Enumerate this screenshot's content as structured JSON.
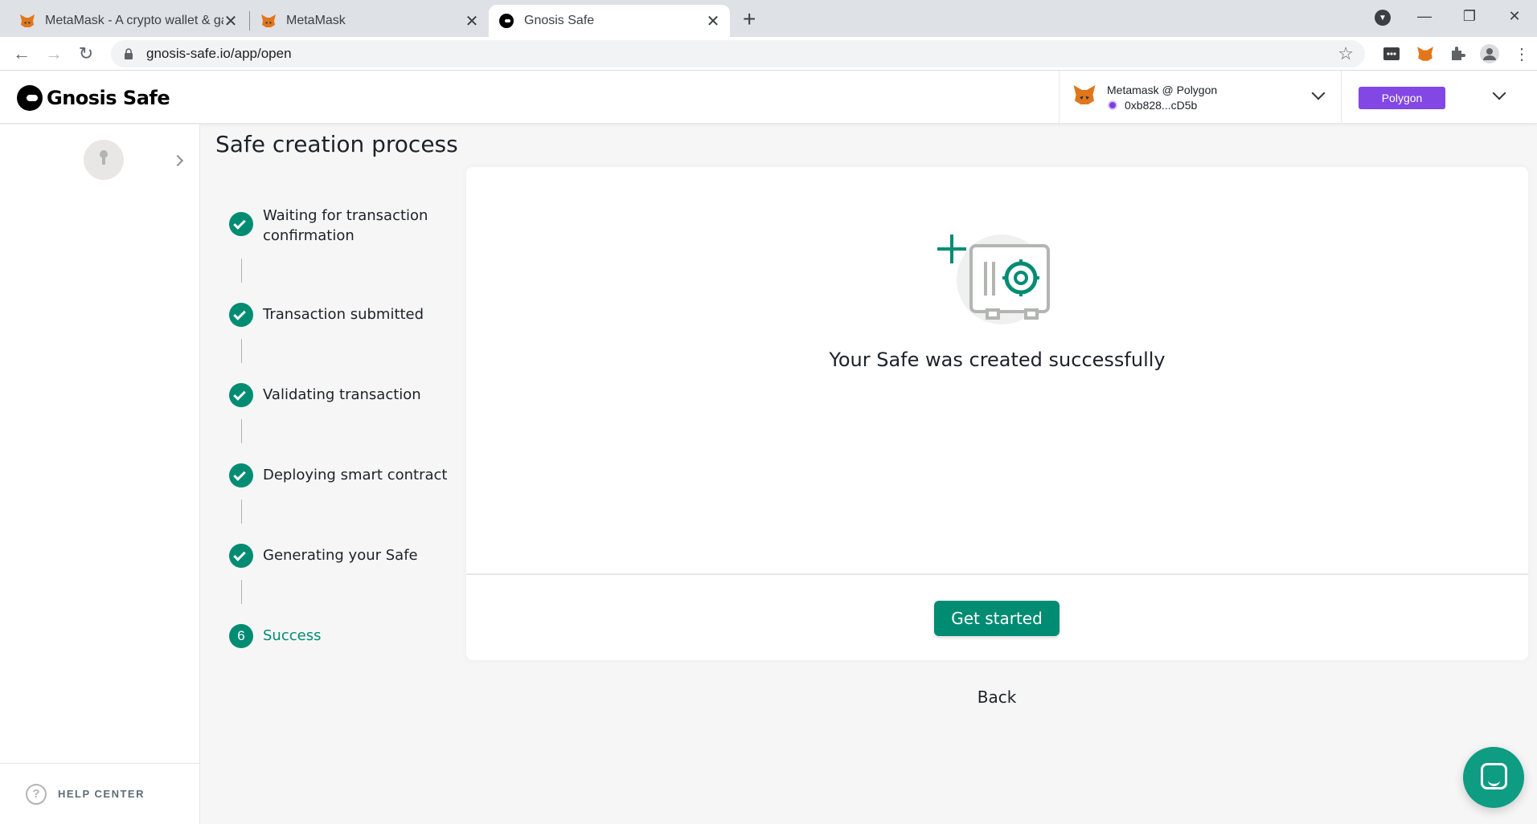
{
  "browser": {
    "tabs": [
      {
        "title": "MetaMask - A crypto wallet & gateway to blockchain apps",
        "icon": "metamask-fox-icon",
        "active": false
      },
      {
        "title": "MetaMask",
        "icon": "metamask-fox-icon",
        "active": false
      },
      {
        "title": "Gnosis Safe",
        "icon": "gnosis-safe-icon",
        "active": true
      }
    ],
    "url": "gnosis-safe.io/app/open"
  },
  "header": {
    "logo_text": "Gnosis Safe",
    "wallet": {
      "name": "Metamask @ Polygon",
      "address": "0xb828...cD5b"
    },
    "network": "Polygon"
  },
  "sidebar": {
    "help_label": "HELP CENTER"
  },
  "main": {
    "title": "Safe creation process",
    "steps": [
      {
        "label": "Waiting for transaction confirmation",
        "status": "done"
      },
      {
        "label": "Transaction submitted",
        "status": "done"
      },
      {
        "label": "Validating transaction",
        "status": "done"
      },
      {
        "label": "Deploying smart contract",
        "status": "done"
      },
      {
        "label": "Generating your Safe",
        "status": "done"
      },
      {
        "label": "Success",
        "status": "active",
        "number": "6"
      }
    ],
    "success_message": "Your Safe was created successfully",
    "primary_button": "Get started",
    "back_button": "Back"
  },
  "colors": {
    "accent": "#008c73",
    "network_badge": "#8247e5",
    "chat_button": "#0e9c83"
  }
}
